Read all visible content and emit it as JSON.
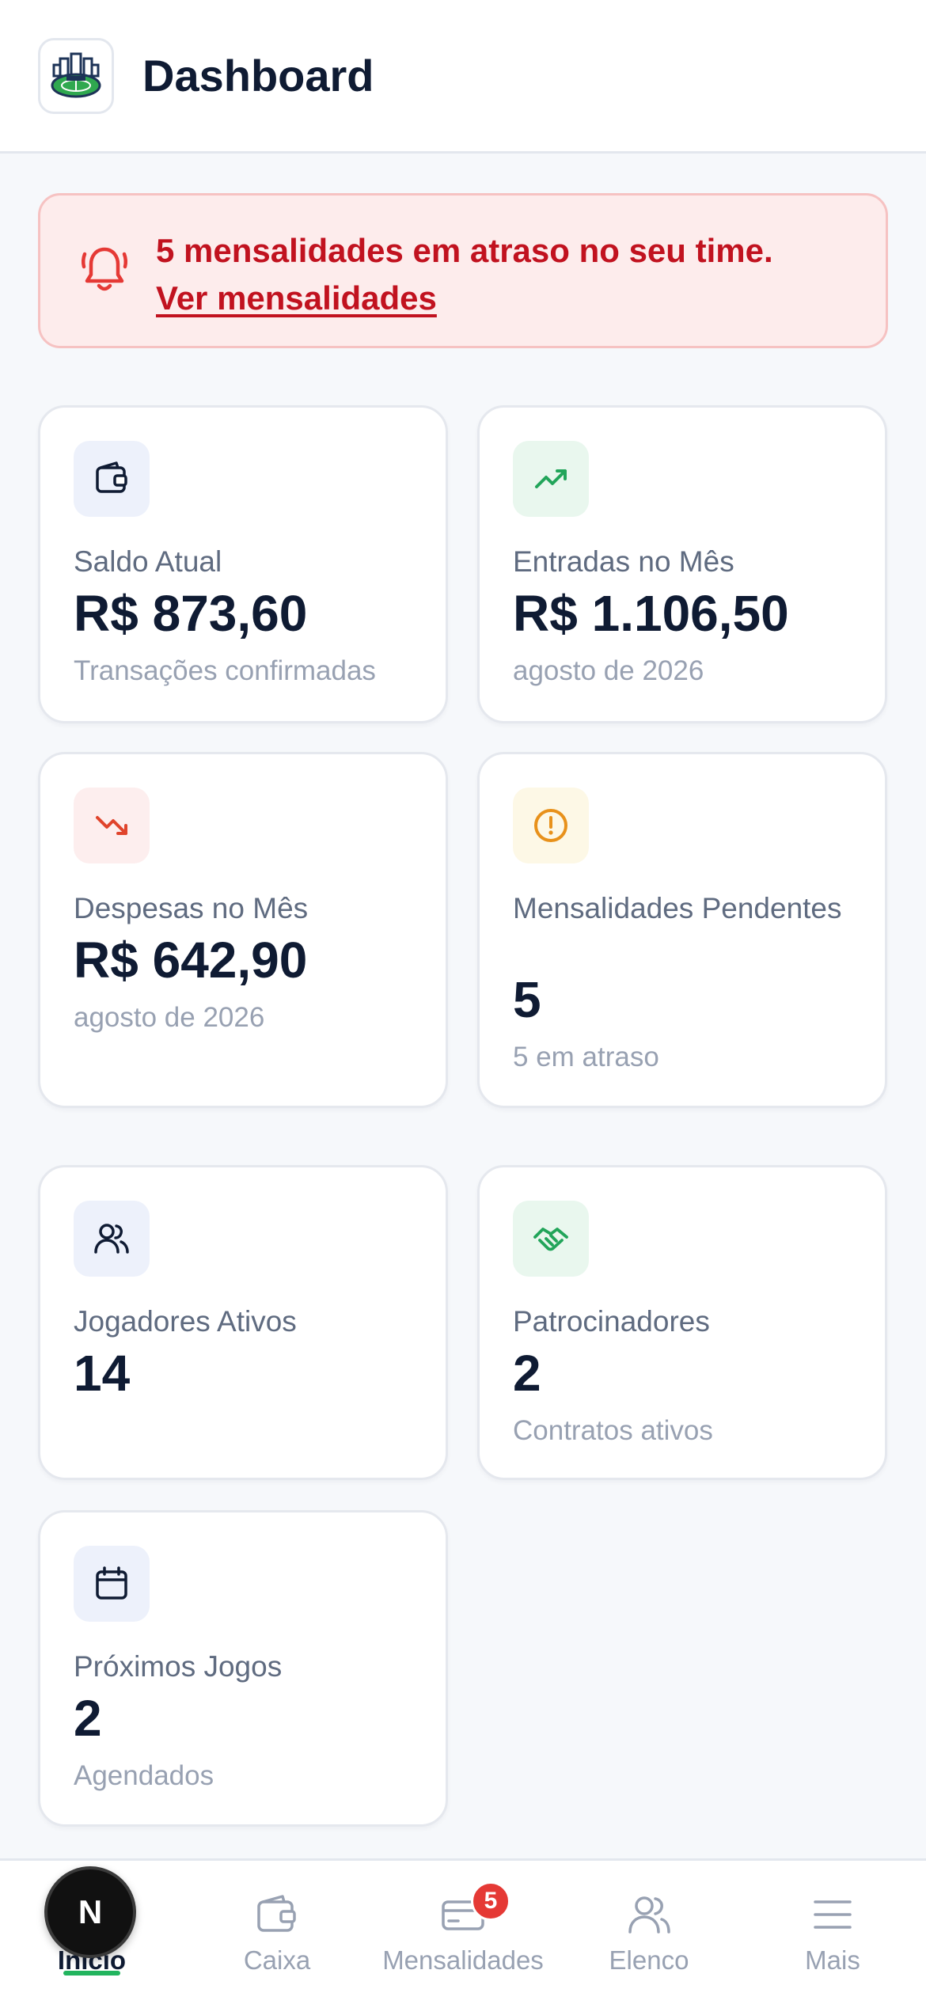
{
  "header": {
    "title": "Dashboard"
  },
  "alert": {
    "message": "5 mensalidades em atraso no seu time.",
    "link": "Ver mensalidades",
    "color": "#c1121f"
  },
  "cards": {
    "saldo": {
      "icon": "wallet-icon",
      "label": "Saldo Atual",
      "value": "R$ 873,60",
      "sub": "Transações confirmadas"
    },
    "entradas": {
      "icon": "trending-up-icon",
      "label": "Entradas no Mês",
      "value": "R$ 1.106,50",
      "sub": "agosto de 2026"
    },
    "despesas": {
      "icon": "trending-down-icon",
      "label": "Despesas no Mês",
      "value": "R$ 642,90",
      "sub": "agosto de 2026"
    },
    "pendentes": {
      "icon": "alert-circle-icon",
      "label": "Mensalidades Pendentes",
      "value": "5",
      "sub": "5 em atraso"
    },
    "jogadores": {
      "icon": "users-icon",
      "label": "Jogadores Ativos",
      "value": "14"
    },
    "patrocinadores": {
      "icon": "handshake-icon",
      "label": "Patrocinadores",
      "value": "2",
      "sub": "Contratos ativos"
    },
    "jogos": {
      "icon": "calendar-icon",
      "label": "Próximos Jogos",
      "value": "2",
      "sub": "Agendados"
    }
  },
  "nav": {
    "items": [
      {
        "label": "Início",
        "icon": "home-icon"
      },
      {
        "label": "Caixa",
        "icon": "wallet-icon"
      },
      {
        "label": "Mensalidades",
        "icon": "card-icon",
        "badge": "5"
      },
      {
        "label": "Elenco",
        "icon": "users-icon"
      },
      {
        "label": "Mais",
        "icon": "menu-icon"
      }
    ],
    "fab_label": "N"
  },
  "colors": {
    "accent_green": "#22b45e",
    "danger": "#e53935",
    "primary_text": "#0f1b33"
  }
}
